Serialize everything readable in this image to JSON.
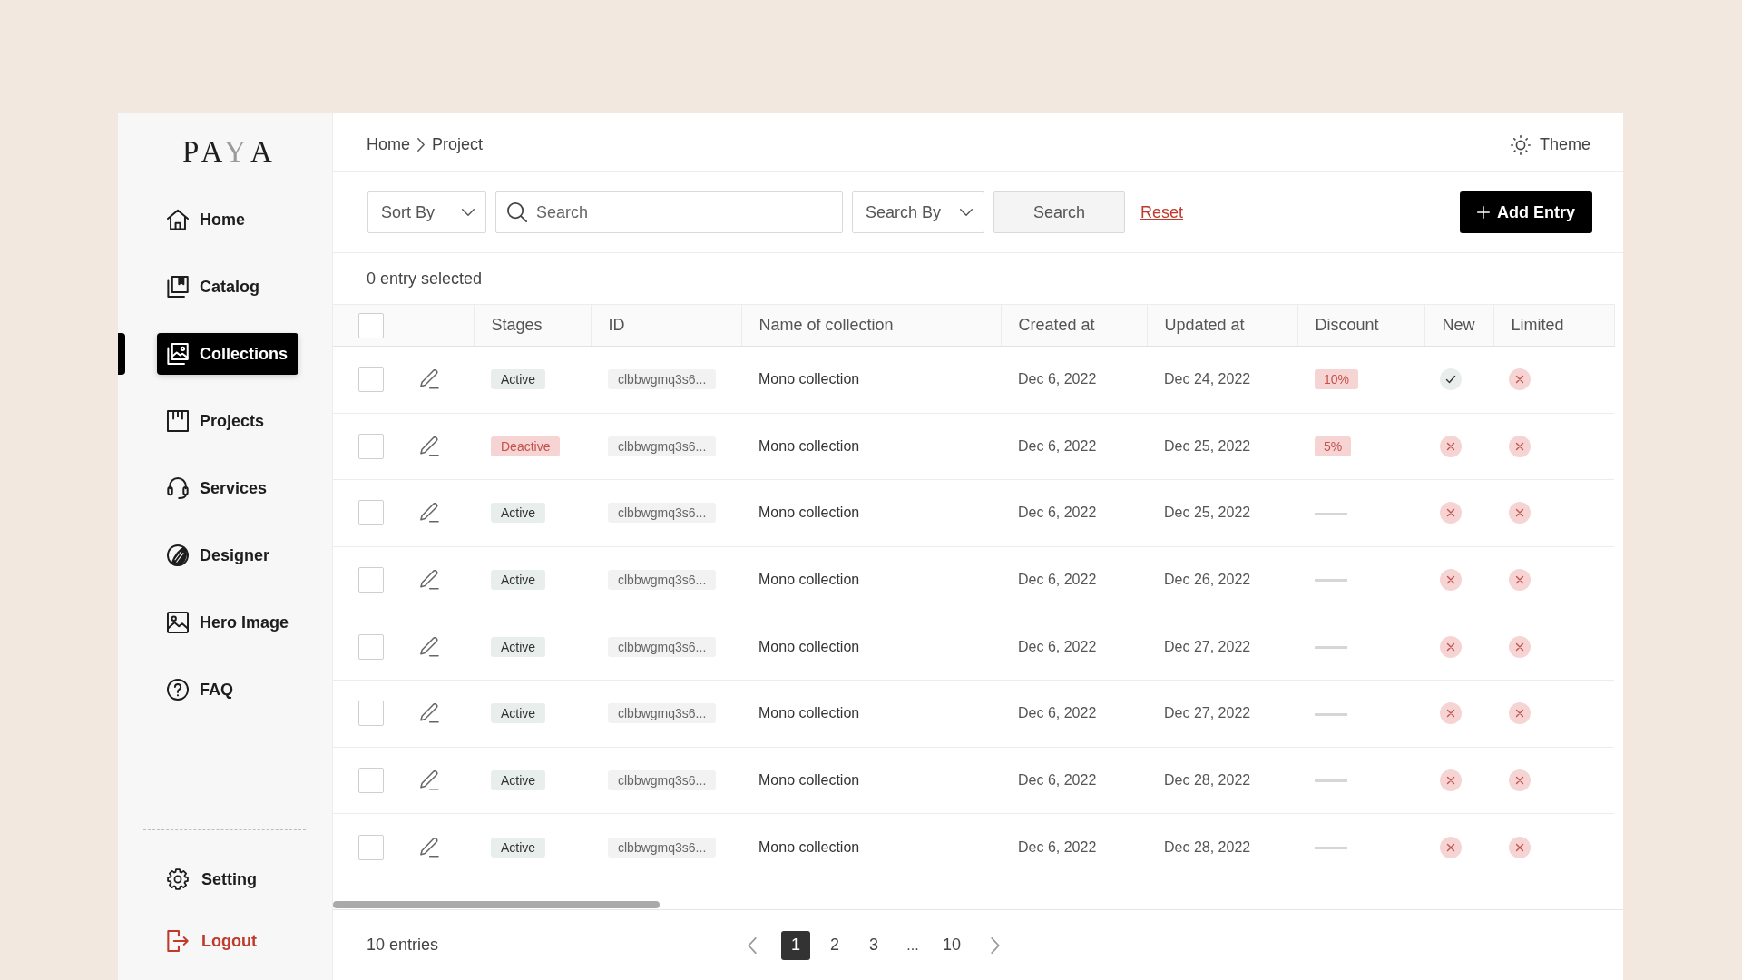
{
  "sidebar": {
    "logo": [
      {
        "text": "PA",
        "accent": false
      },
      {
        "text": "Y",
        "accent": true
      },
      {
        "text": "A",
        "accent": false
      }
    ],
    "items": [
      {
        "label": "Home",
        "selected": false
      },
      {
        "label": "Catalog",
        "selected": false
      },
      {
        "label": "Collections",
        "selected": true
      },
      {
        "label": "Projects",
        "selected": false
      },
      {
        "label": "Services",
        "selected": false
      },
      {
        "label": "Designer",
        "selected": false
      },
      {
        "label": "Hero Image",
        "selected": false
      },
      {
        "label": "FAQ",
        "selected": false
      }
    ],
    "bottom_items": [
      {
        "label": "Setting",
        "kind": "plain"
      },
      {
        "label": "Logout",
        "kind": "danger"
      }
    ]
  },
  "header": {
    "breadcrumb": [
      "Home",
      "Project"
    ],
    "theme_toggle": "Theme"
  },
  "toolbar": {
    "sort_by": "Sort By",
    "search": {
      "placeholder": "Search"
    },
    "search_by": "Search By",
    "search_button": "Search",
    "reset": "Reset",
    "add_button": "Add Entry"
  },
  "selection_status": "0 entry selected",
  "table": {
    "select_all": {
      "checked": false
    },
    "columns": [
      "Stages",
      "ID",
      "Name of collection",
      "Created at",
      "Updated at",
      "Discount",
      "New",
      "Limited"
    ],
    "rows": [
      {
        "selected": false,
        "stage": {
          "kind": "active",
          "label": "Active"
        },
        "id": "clbbwgmq3s6...",
        "name": "Mono collection",
        "created": "Dec 6, 2022",
        "updated": "Dec 24, 2022",
        "discount": {
          "kind": "percent",
          "label": "10%"
        },
        "new": true,
        "limited": false
      },
      {
        "selected": false,
        "stage": {
          "kind": "deactive",
          "label": "Deactive"
        },
        "id": "clbbwgmq3s6...",
        "name": "Mono collection",
        "created": "Dec 6, 2022",
        "updated": "Dec 25, 2022",
        "discount": {
          "kind": "percent",
          "label": "5%"
        },
        "new": false,
        "limited": false
      },
      {
        "selected": false,
        "stage": {
          "kind": "active",
          "label": "Active"
        },
        "id": "clbbwgmq3s6...",
        "name": "Mono collection",
        "created": "Dec 6, 2022",
        "updated": "Dec 25, 2022",
        "discount": {
          "kind": "none"
        },
        "new": false,
        "limited": false
      },
      {
        "selected": false,
        "stage": {
          "kind": "active",
          "label": "Active"
        },
        "id": "clbbwgmq3s6...",
        "name": "Mono collection",
        "created": "Dec 6, 2022",
        "updated": "Dec 26, 2022",
        "discount": {
          "kind": "none"
        },
        "new": false,
        "limited": false
      },
      {
        "selected": false,
        "stage": {
          "kind": "active",
          "label": "Active"
        },
        "id": "clbbwgmq3s6...",
        "name": "Mono collection",
        "created": "Dec 6, 2022",
        "updated": "Dec 27, 2022",
        "discount": {
          "kind": "none"
        },
        "new": false,
        "limited": false
      },
      {
        "selected": false,
        "stage": {
          "kind": "active",
          "label": "Active"
        },
        "id": "clbbwgmq3s6...",
        "name": "Mono collection",
        "created": "Dec 6, 2022",
        "updated": "Dec 27, 2022",
        "discount": {
          "kind": "none"
        },
        "new": false,
        "limited": false
      },
      {
        "selected": false,
        "stage": {
          "kind": "active",
          "label": "Active"
        },
        "id": "clbbwgmq3s6...",
        "name": "Mono collection",
        "created": "Dec 6, 2022",
        "updated": "Dec 28, 2022",
        "discount": {
          "kind": "none"
        },
        "new": false,
        "limited": false
      },
      {
        "selected": false,
        "stage": {
          "kind": "active",
          "label": "Active"
        },
        "id": "clbbwgmq3s6...",
        "name": "Mono collection",
        "created": "Dec 6, 2022",
        "updated": "Dec 28, 2022",
        "discount": {
          "kind": "none"
        },
        "new": false,
        "limited": false
      }
    ]
  },
  "footer": {
    "entries": "10 entries",
    "pagination": [
      {
        "kind": "page",
        "label": "1",
        "selected": true
      },
      {
        "kind": "page",
        "label": "2",
        "selected": false
      },
      {
        "kind": "page",
        "label": "3",
        "selected": false
      },
      {
        "kind": "ellipsis",
        "label": "...",
        "selected": false
      },
      {
        "kind": "page",
        "label": "10",
        "selected": false
      }
    ]
  }
}
